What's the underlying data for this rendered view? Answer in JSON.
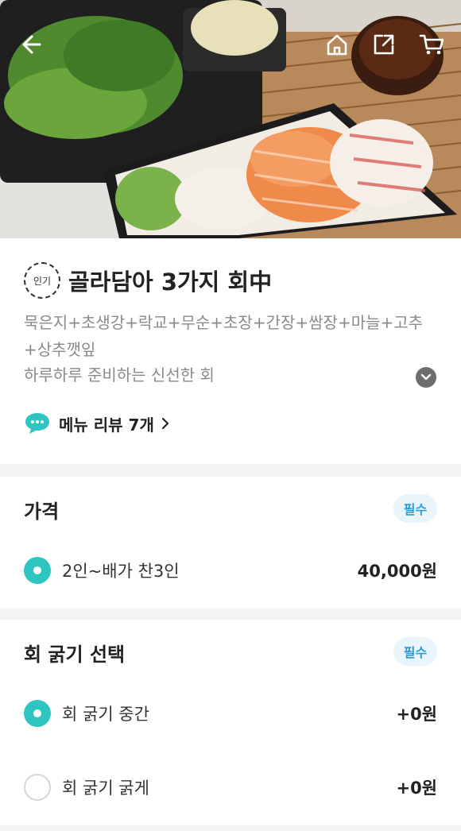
{
  "header": {
    "back_icon": "arrow-left-icon",
    "home_icon": "home-icon",
    "share_icon": "share-icon",
    "cart_icon": "cart-icon"
  },
  "menu": {
    "badge": "인기",
    "title": "골라담아 3가지 회中",
    "description": "묵은지+초생강+락교+무순+초장+간장+쌈장+마늘+고추+상추깻잎",
    "subtitle": "하루하루 준비하는 신선한 회",
    "review_link": "메뉴 리뷰 7개"
  },
  "price_section": {
    "title": "가격",
    "required": "필수",
    "options": [
      {
        "label": "2인~배가 찬3인",
        "price": "40,000원",
        "selected": true
      }
    ]
  },
  "thickness_section": {
    "title": "회 굵기 선택",
    "required": "필수",
    "options": [
      {
        "label": "회 굵기 중간",
        "price": "+0원",
        "selected": true
      },
      {
        "label": "회 굵기 굵게",
        "price": "+0원",
        "selected": false
      }
    ]
  },
  "colors": {
    "accent": "#2ec4c0",
    "required_text": "#2b9cd8",
    "required_bg": "#e9f5fb"
  }
}
